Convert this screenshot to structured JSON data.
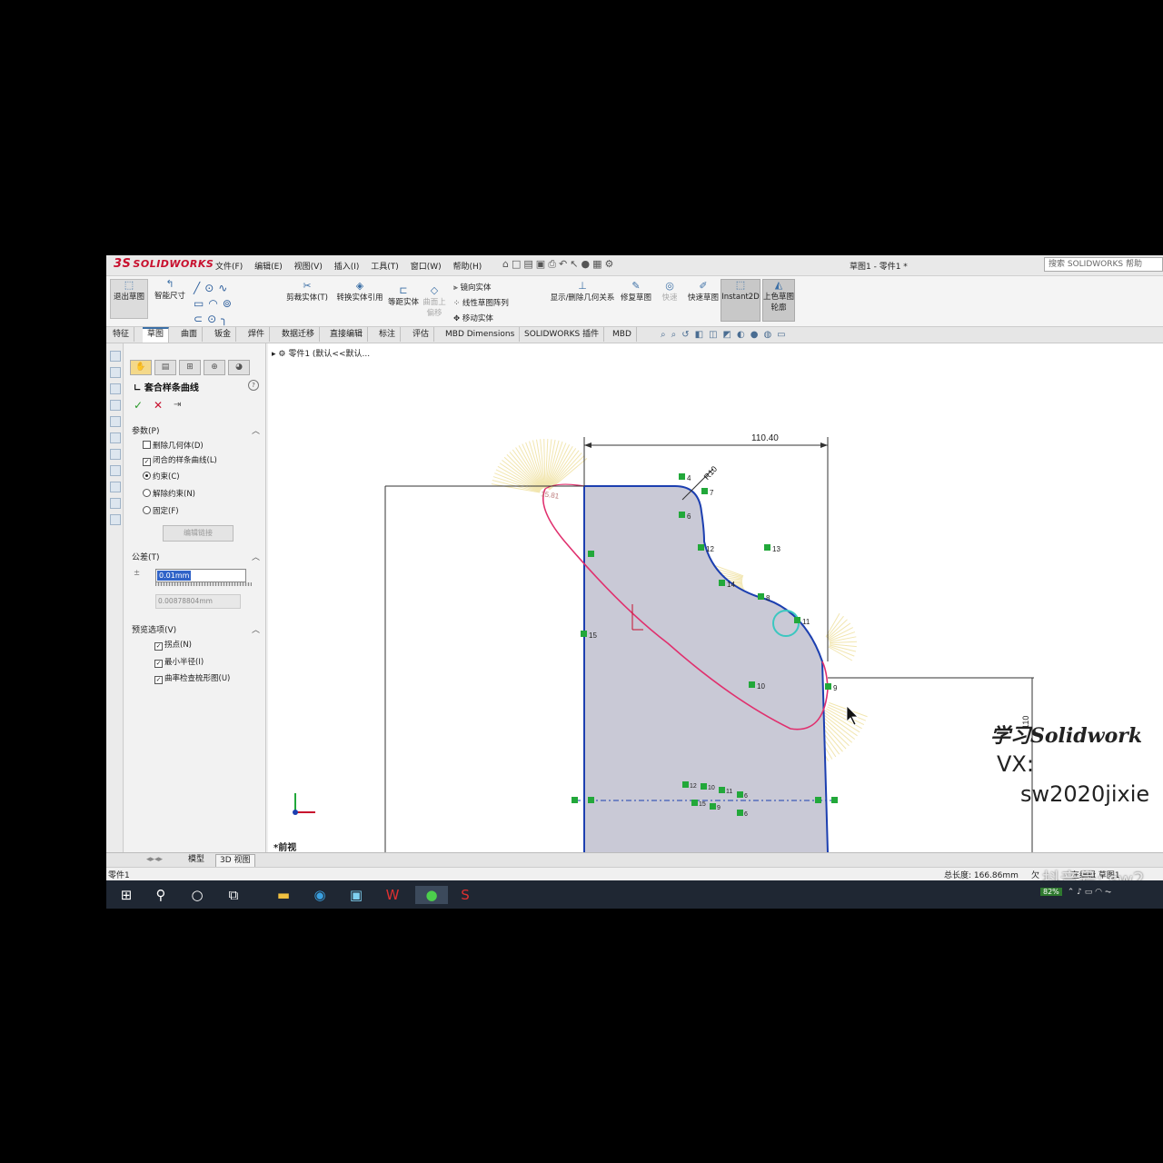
{
  "app": {
    "logo_ds": "3S",
    "logo_text": "SOLIDWORKS",
    "menu": [
      "文件(F)",
      "编辑(E)",
      "视图(V)",
      "插入(I)",
      "工具(T)",
      "窗口(W)",
      "帮助(H)"
    ],
    "document_title": "草图1 - 零件1 *",
    "search_placeholder": "搜索 SOLIDWORKS 帮助"
  },
  "commands": {
    "exit_sketch": "退出草图",
    "smart_dimension": "智能尺寸",
    "trim": "剪裁实体(T)",
    "convert": "转换实体引用",
    "offset": "等距实体",
    "sketch_on_surface": "曲面上偏移",
    "mirror": "镜向实体",
    "linear_pattern": "线性草图阵列",
    "move": "移动实体",
    "display_relations": "显示/删除几何关系",
    "repair": "修复草图",
    "quick_snap": "快速",
    "rapid_sketch": "快速草图",
    "instant2d": "Instant2D",
    "shaded": "上色草图轮廓"
  },
  "tabs": [
    "特征",
    "草图",
    "曲面",
    "钣金",
    "焊件",
    "数据迁移",
    "直接编辑",
    "标注",
    "评估",
    "MBD Dimensions",
    "SOLIDWORKS 插件",
    "MBD"
  ],
  "active_tab": "草图",
  "property_manager": {
    "title": "套合样条曲线",
    "params_header": "参数(P)",
    "opt_delete_geometry": "删除几何体(D)",
    "opt_closed_spline": "闭合的样条曲线(L)",
    "radio_constrained": "约束(C)",
    "radio_unconstrained": "解除约束(N)",
    "radio_fixed": "固定(F)",
    "edit_link_button": "编辑链接",
    "tolerance_header": "公差(T)",
    "tolerance_value": "0.01mm",
    "tolerance_calc": "0.00878804mm",
    "preview_header": "预览选项(V)",
    "opt_inflection": "拐点(N)",
    "opt_min_radius": "最小半径(I)",
    "opt_curvature_comb": "曲率检查梳形图(U)"
  },
  "canvas": {
    "breadcrumb": "零件1 (默认<<默认...",
    "view_label": "*前视",
    "dim_width": "110.40",
    "dim_radius": "R10",
    "dim_height": "110",
    "dim_angle": "15.81",
    "point_labels": [
      "4",
      "7",
      "6",
      "12",
      "13",
      "14",
      "8",
      "11",
      "10",
      "9",
      "15",
      "1"
    ],
    "cluster_labels": [
      "12",
      "10",
      "11",
      "6",
      "15",
      "9",
      "6"
    ],
    "watermark_line1": "学习Solidwork",
    "watermark_line2": "VX:",
    "watermark_line3": "sw2020jixie"
  },
  "bottom_tabs": [
    "模型",
    "3D 视图"
  ],
  "status": {
    "left": "零件1",
    "total_length": "总长度: 166.86mm",
    "under_defined": "欠",
    "editing": "在编辑 草图1"
  },
  "overlay": {
    "douyin": "抖音号: sw2"
  },
  "tray": {
    "battery": "82%"
  },
  "colors": {
    "accent": "#3a6ea5",
    "spline": "#e0306e",
    "sketch_line": "#1c3fb0",
    "region_fill": "#c9c9d6",
    "relation_green": "#22a83a",
    "comb": "#f2e6b0"
  }
}
